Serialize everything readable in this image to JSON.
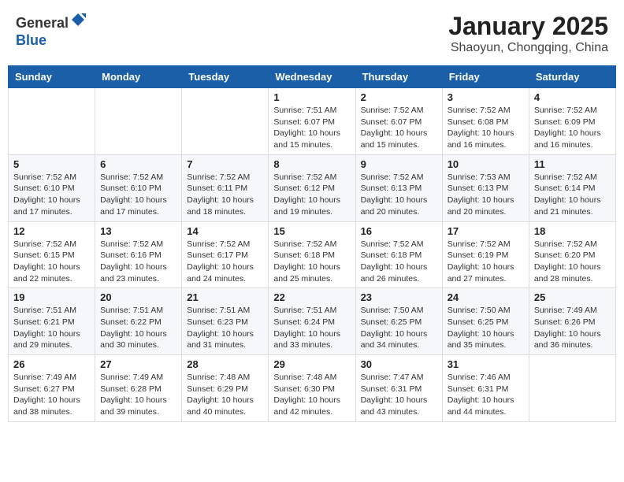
{
  "header": {
    "logo_line1": "General",
    "logo_line2": "Blue",
    "month_title": "January 2025",
    "subtitle": "Shaoyun, Chongqing, China"
  },
  "weekdays": [
    "Sunday",
    "Monday",
    "Tuesday",
    "Wednesday",
    "Thursday",
    "Friday",
    "Saturday"
  ],
  "weeks": [
    [
      {
        "day": "",
        "info": ""
      },
      {
        "day": "",
        "info": ""
      },
      {
        "day": "",
        "info": ""
      },
      {
        "day": "1",
        "info": "Sunrise: 7:51 AM\nSunset: 6:07 PM\nDaylight: 10 hours\nand 15 minutes."
      },
      {
        "day": "2",
        "info": "Sunrise: 7:52 AM\nSunset: 6:07 PM\nDaylight: 10 hours\nand 15 minutes."
      },
      {
        "day": "3",
        "info": "Sunrise: 7:52 AM\nSunset: 6:08 PM\nDaylight: 10 hours\nand 16 minutes."
      },
      {
        "day": "4",
        "info": "Sunrise: 7:52 AM\nSunset: 6:09 PM\nDaylight: 10 hours\nand 16 minutes."
      }
    ],
    [
      {
        "day": "5",
        "info": "Sunrise: 7:52 AM\nSunset: 6:10 PM\nDaylight: 10 hours\nand 17 minutes."
      },
      {
        "day": "6",
        "info": "Sunrise: 7:52 AM\nSunset: 6:10 PM\nDaylight: 10 hours\nand 17 minutes."
      },
      {
        "day": "7",
        "info": "Sunrise: 7:52 AM\nSunset: 6:11 PM\nDaylight: 10 hours\nand 18 minutes."
      },
      {
        "day": "8",
        "info": "Sunrise: 7:52 AM\nSunset: 6:12 PM\nDaylight: 10 hours\nand 19 minutes."
      },
      {
        "day": "9",
        "info": "Sunrise: 7:52 AM\nSunset: 6:13 PM\nDaylight: 10 hours\nand 20 minutes."
      },
      {
        "day": "10",
        "info": "Sunrise: 7:53 AM\nSunset: 6:13 PM\nDaylight: 10 hours\nand 20 minutes."
      },
      {
        "day": "11",
        "info": "Sunrise: 7:52 AM\nSunset: 6:14 PM\nDaylight: 10 hours\nand 21 minutes."
      }
    ],
    [
      {
        "day": "12",
        "info": "Sunrise: 7:52 AM\nSunset: 6:15 PM\nDaylight: 10 hours\nand 22 minutes."
      },
      {
        "day": "13",
        "info": "Sunrise: 7:52 AM\nSunset: 6:16 PM\nDaylight: 10 hours\nand 23 minutes."
      },
      {
        "day": "14",
        "info": "Sunrise: 7:52 AM\nSunset: 6:17 PM\nDaylight: 10 hours\nand 24 minutes."
      },
      {
        "day": "15",
        "info": "Sunrise: 7:52 AM\nSunset: 6:18 PM\nDaylight: 10 hours\nand 25 minutes."
      },
      {
        "day": "16",
        "info": "Sunrise: 7:52 AM\nSunset: 6:18 PM\nDaylight: 10 hours\nand 26 minutes."
      },
      {
        "day": "17",
        "info": "Sunrise: 7:52 AM\nSunset: 6:19 PM\nDaylight: 10 hours\nand 27 minutes."
      },
      {
        "day": "18",
        "info": "Sunrise: 7:52 AM\nSunset: 6:20 PM\nDaylight: 10 hours\nand 28 minutes."
      }
    ],
    [
      {
        "day": "19",
        "info": "Sunrise: 7:51 AM\nSunset: 6:21 PM\nDaylight: 10 hours\nand 29 minutes."
      },
      {
        "day": "20",
        "info": "Sunrise: 7:51 AM\nSunset: 6:22 PM\nDaylight: 10 hours\nand 30 minutes."
      },
      {
        "day": "21",
        "info": "Sunrise: 7:51 AM\nSunset: 6:23 PM\nDaylight: 10 hours\nand 31 minutes."
      },
      {
        "day": "22",
        "info": "Sunrise: 7:51 AM\nSunset: 6:24 PM\nDaylight: 10 hours\nand 33 minutes."
      },
      {
        "day": "23",
        "info": "Sunrise: 7:50 AM\nSunset: 6:25 PM\nDaylight: 10 hours\nand 34 minutes."
      },
      {
        "day": "24",
        "info": "Sunrise: 7:50 AM\nSunset: 6:25 PM\nDaylight: 10 hours\nand 35 minutes."
      },
      {
        "day": "25",
        "info": "Sunrise: 7:49 AM\nSunset: 6:26 PM\nDaylight: 10 hours\nand 36 minutes."
      }
    ],
    [
      {
        "day": "26",
        "info": "Sunrise: 7:49 AM\nSunset: 6:27 PM\nDaylight: 10 hours\nand 38 minutes."
      },
      {
        "day": "27",
        "info": "Sunrise: 7:49 AM\nSunset: 6:28 PM\nDaylight: 10 hours\nand 39 minutes."
      },
      {
        "day": "28",
        "info": "Sunrise: 7:48 AM\nSunset: 6:29 PM\nDaylight: 10 hours\nand 40 minutes."
      },
      {
        "day": "29",
        "info": "Sunrise: 7:48 AM\nSunset: 6:30 PM\nDaylight: 10 hours\nand 42 minutes."
      },
      {
        "day": "30",
        "info": "Sunrise: 7:47 AM\nSunset: 6:31 PM\nDaylight: 10 hours\nand 43 minutes."
      },
      {
        "day": "31",
        "info": "Sunrise: 7:46 AM\nSunset: 6:31 PM\nDaylight: 10 hours\nand 44 minutes."
      },
      {
        "day": "",
        "info": ""
      }
    ]
  ]
}
